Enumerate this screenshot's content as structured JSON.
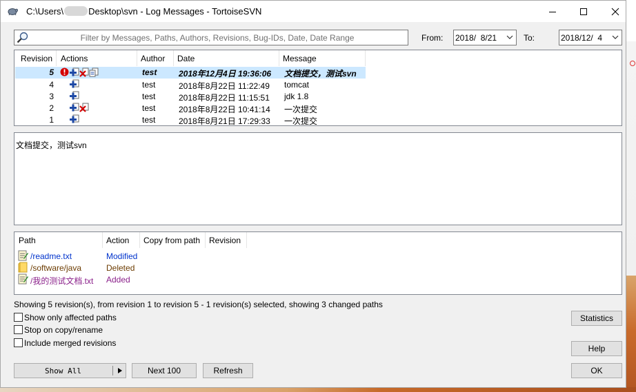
{
  "window": {
    "title_prefix": "C:\\Users\\",
    "title_suffix": "Desktop\\svn - Log Messages - TortoiseSVN"
  },
  "filter": {
    "placeholder": "Filter by Messages, Paths, Authors, Revisions, Bug-IDs, Date, Date Range"
  },
  "dates": {
    "from_label": "From:",
    "from_value": "2018/  8/21",
    "to_label": "To:",
    "to_value": "2018/12/  4"
  },
  "log_table": {
    "headers": [
      "Revision",
      "Actions",
      "Author",
      "Date",
      "Message"
    ],
    "rows": [
      {
        "revision": "5",
        "actions": [
          "conflict-icon",
          "added-icon",
          "deleted-icon",
          "modified-icon"
        ],
        "author": "test",
        "date": "2018年12月4日 19:36:06",
        "message": "文档提交，测试svn",
        "selected": true
      },
      {
        "revision": "4",
        "actions": [
          "added-icon"
        ],
        "author": "test",
        "date": "2018年8月22日 11:22:49",
        "message": "tomcat",
        "selected": false
      },
      {
        "revision": "3",
        "actions": [
          "added-icon"
        ],
        "author": "test",
        "date": "2018年8月22日 11:15:51",
        "message": "jdk 1.8",
        "selected": false
      },
      {
        "revision": "2",
        "actions": [
          "added-icon",
          "deleted-icon"
        ],
        "author": "test",
        "date": "2018年8月22日 10:41:14",
        "message": "一次提交",
        "selected": false
      },
      {
        "revision": "1",
        "actions": [
          "added-icon"
        ],
        "author": "test",
        "date": "2018年8月21日 17:29:33",
        "message": "一次提交",
        "selected": false
      }
    ]
  },
  "message_text": "文档提交，测试svn",
  "paths_table": {
    "headers": [
      "Path",
      "Action",
      "Copy from path",
      "Revision"
    ],
    "rows": [
      {
        "path": "/readme.txt",
        "action": "Modified",
        "icon": "text-file-icon"
      },
      {
        "path": "/software/java",
        "action": "Deleted",
        "icon": "folder-icon"
      },
      {
        "path": "/我的测试文档.txt",
        "action": "Added",
        "icon": "text-file-icon"
      }
    ]
  },
  "status_text": "Showing 5 revision(s), from revision 1 to revision 5 - 1 revision(s) selected, showing 3 changed paths",
  "options": {
    "show_affected": "Show only affected paths",
    "stop_on_copy": "Stop on copy/rename",
    "include_merged": "Include merged revisions"
  },
  "buttons": {
    "statistics": "Statistics",
    "help": "Help",
    "show_all": "Show All",
    "next100": "Next 100",
    "refresh": "Refresh",
    "ok": "OK"
  },
  "colors": {
    "selection": "#cce8ff",
    "path_link": "#0033cc",
    "deleted": "#6b3b00",
    "added": "#8a1f8a"
  }
}
